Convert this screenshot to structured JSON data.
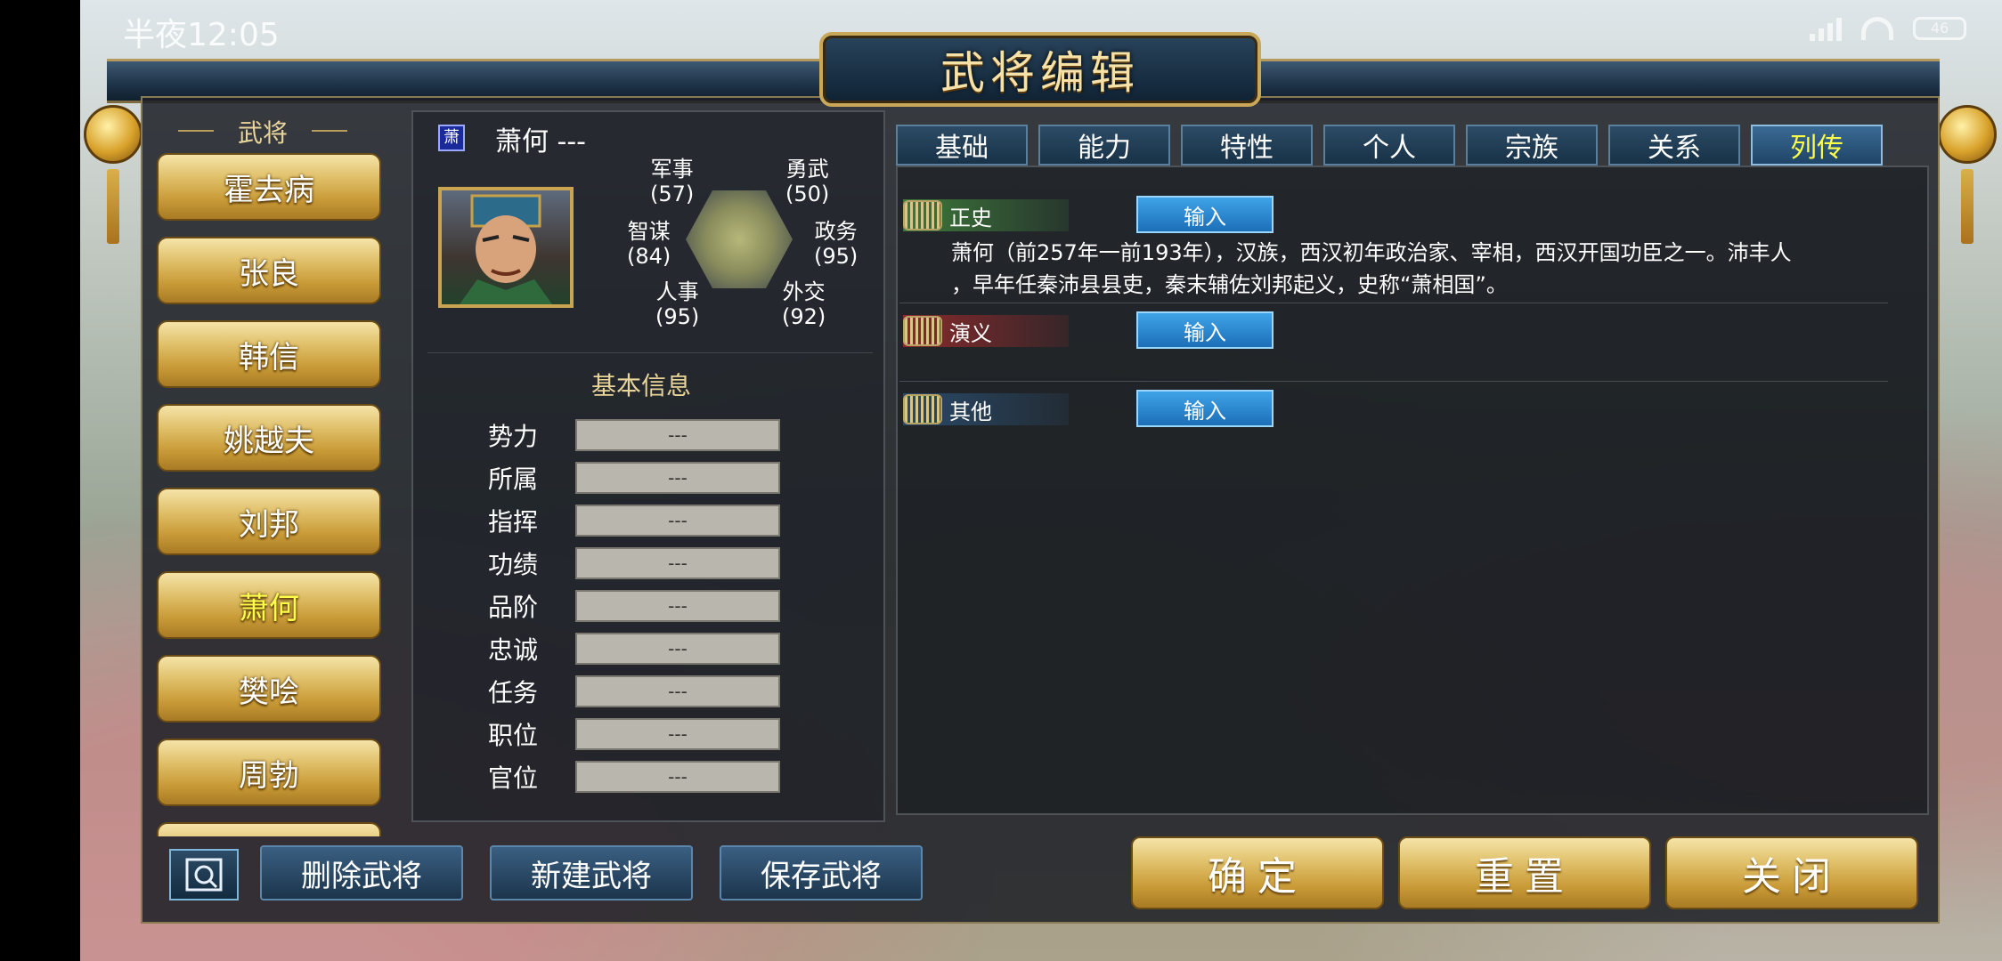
{
  "status_bar": {
    "time": "半夜12:05",
    "battery": "46"
  },
  "title": "武将编辑",
  "roster": {
    "title": "武将",
    "generals": [
      "霍去病",
      "张良",
      "韩信",
      "姚越夫",
      "刘邦",
      "萧何",
      "樊哙",
      "周勃"
    ],
    "selected": "萧何"
  },
  "character": {
    "badge": "萧",
    "name_line": "萧何 ---",
    "stats": {
      "military": {
        "label": "军事",
        "value": "(57)"
      },
      "valor": {
        "label": "勇武",
        "value": "(50)"
      },
      "strategy": {
        "label": "智谋",
        "value": "(84)"
      },
      "politics": {
        "label": "政务",
        "value": "(95)"
      },
      "personnel": {
        "label": "人事",
        "value": "(95)"
      },
      "diplomacy": {
        "label": "外交",
        "value": "(92)"
      }
    }
  },
  "basic_info": {
    "title": "基本信息",
    "rows": [
      {
        "label": "势力",
        "value": "---"
      },
      {
        "label": "所属",
        "value": "---"
      },
      {
        "label": "指挥",
        "value": "---"
      },
      {
        "label": "功绩",
        "value": "---"
      },
      {
        "label": "品阶",
        "value": "---"
      },
      {
        "label": "忠诚",
        "value": "---"
      },
      {
        "label": "任务",
        "value": "---"
      },
      {
        "label": "职位",
        "value": "---"
      },
      {
        "label": "官位",
        "value": "---"
      }
    ]
  },
  "tabs": [
    "基础",
    "能力",
    "特性",
    "个人",
    "宗族",
    "关系",
    "列传"
  ],
  "active_tab": "列传",
  "biography": {
    "sections": [
      {
        "label": "正史",
        "input_label": "输入",
        "color": "#3d7a3a"
      },
      {
        "label": "演义",
        "input_label": "输入",
        "color": "#8a2a2a"
      },
      {
        "label": "其他",
        "input_label": "输入",
        "color": "#2a4a6a"
      }
    ],
    "official_text_line1": "萧何（前257年一前193年），汉族，西汉初年政治家、宰相，西汉开国功臣之一。沛丰人",
    "official_text_line2": "，早年任秦沛县县吏，秦末辅佐刘邦起义，史称“萧相国”。"
  },
  "bottom": {
    "delete": "删除武将",
    "create": "新建武将",
    "save": "保存武将",
    "confirm": "确定",
    "reset": "重置",
    "close": "关闭"
  }
}
